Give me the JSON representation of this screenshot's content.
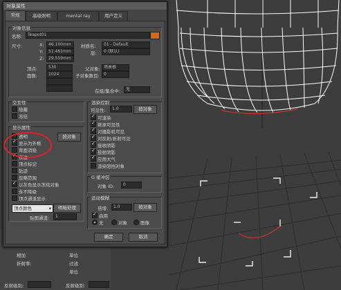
{
  "dialog": {
    "title": "对象属性",
    "tabs": [
      "常规",
      "高级照明",
      "mental ray",
      "用户定义"
    ],
    "object_info": {
      "group_title": "对象信息",
      "name_label": "名称:",
      "name_value": "Teapot01",
      "color": "#d2691e",
      "dims_label": "尺寸:",
      "x_label": "X:",
      "x_value": "46.100mm",
      "y_label": "Y:",
      "y_value": "51.461mm",
      "z_label": "Z:",
      "z_value": "29.559mm",
      "material_label": "材质名:",
      "material_value": "01 - Default",
      "layer_label": "层:",
      "layer_value": "0 (默认)",
      "verts_label": "顶点:",
      "verts_value": "530",
      "faces_label": "面数:",
      "faces_value": "1024",
      "parent_label": "父对象:",
      "parent_value": "场景根",
      "children_label": "子对象数目:",
      "children_value": "0",
      "ingroup_label": "在组/集合中:",
      "ingroup_value": "无"
    },
    "interactivity": {
      "group_title": "交互性",
      "items": [
        {
          "label": "隐藏",
          "checked": false
        },
        {
          "label": "冻结",
          "checked": false
        }
      ]
    },
    "display": {
      "group_title": "显示属性",
      "by_object_button": "按对象",
      "items": [
        {
          "label": "透明",
          "checked": false
        },
        {
          "label": "显示为外框",
          "checked": true
        },
        {
          "label": "背面消隐",
          "checked": false
        },
        {
          "label": "仅边",
          "checked": true
        },
        {
          "label": "顶点标记",
          "checked": false
        },
        {
          "label": "轨迹",
          "checked": false
        },
        {
          "label": "忽略范围",
          "checked": false
        },
        {
          "label": "以灰色显示冻结对象",
          "checked": true
        },
        {
          "label": "永不降级",
          "checked": false
        },
        {
          "label": "顶点通道显示",
          "checked": false
        }
      ],
      "vertex_color_select": "顶点颜色",
      "shaded_button": "明暗处理",
      "map_channel_label": "贴图通道:",
      "map_channel_value": "1"
    },
    "render": {
      "group_title": "渲染控制",
      "visibility_label": "可见性:",
      "visibility_value": "1.0",
      "by_object_button": "按对象",
      "items": [
        {
          "label": "可渲染",
          "checked": true
        },
        {
          "label": "继承可见性",
          "checked": true
        },
        {
          "label": "对摄影机可见",
          "checked": true
        },
        {
          "label": "对反射/折射可见",
          "checked": true
        },
        {
          "label": "接收阴影",
          "checked": true
        },
        {
          "label": "投射阴影",
          "checked": true
        },
        {
          "label": "应用大气",
          "checked": true
        },
        {
          "label": "渲染阻挡对象",
          "checked": false
        }
      ]
    },
    "gbuffer": {
      "group_title": "G 缓冲区",
      "object_id_label": "对象 ID:",
      "object_id_value": "0"
    },
    "motion_blur": {
      "group_title": "运动模糊",
      "multiplier_label": "倍增:",
      "multiplier_value": "1.0",
      "by_object_button": "按对象",
      "enabled_label": "启用",
      "enabled_checked": true,
      "radios": [
        {
          "label": "无",
          "on": true
        },
        {
          "label": "对象",
          "on": false
        },
        {
          "label": "图像",
          "on": false
        }
      ]
    },
    "ok_button": "确定",
    "cancel_button": "取消"
  },
  "background_panel": {
    "labels": [
      "相加",
      "折射率:",
      "单位",
      "过滤",
      "暗淡",
      "单位"
    ],
    "bottom_labels": [
      "反射级别:",
      "反射级别:"
    ]
  },
  "colors": {
    "annotation": "#e0202a",
    "selection": "#c83232",
    "wire": "#ffffff"
  }
}
